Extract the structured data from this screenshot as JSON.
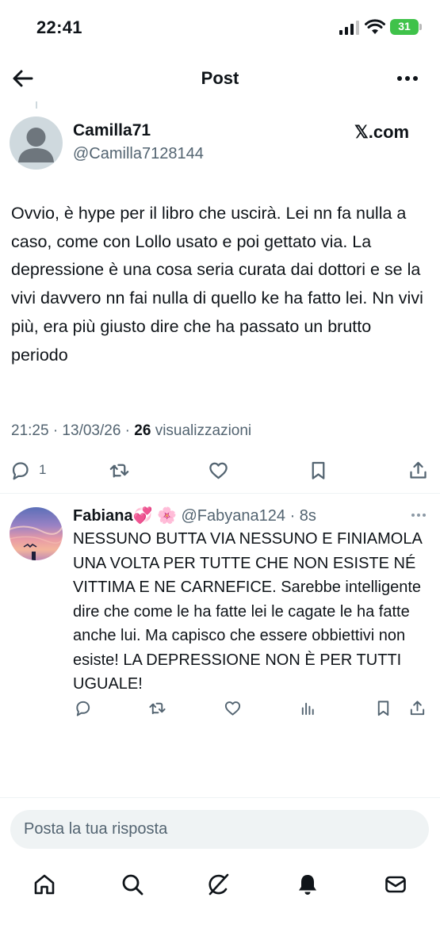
{
  "status_bar": {
    "time": "22:41",
    "battery": "31"
  },
  "header": {
    "title": "Post"
  },
  "post": {
    "author_name": "Camilla71",
    "author_handle": "@Camilla7128144",
    "brand": "𝕏.com",
    "text": "Ovvio, è hype per il libro che uscirà. Lei nn fa nulla a caso, come con Lollo usato e poi gettato via. La depressione è una cosa seria curata dai dottori e se la vivi davvero nn fai nulla di quello ke ha fatto lei. Nn vivi più, era più giusto dire che ha passato un brutto periodo",
    "timestamp": "21:25 · 13/03/26 · ",
    "views_count": "26",
    "views_label": " visualizzazioni",
    "reply_count": "1"
  },
  "reply": {
    "name": "Fabiana💞 🌸",
    "handle": "@Fabyana124",
    "time": " · 8s",
    "text": "NESSUNO BUTTA VIA NESSUNO E FINIAMOLA UNA VOLTA PER TUTTE CHE NON ESISTE NÉ VITTIMA E NE CARNEFICE. Sarebbe intelligente dire che come le ha fatte lei le cagate le ha fatte anche lui. Ma capisco che essere obbiettivi non esiste! LA DEPRESSIONE NON È PER TUTTI UGUALE!"
  },
  "composer": {
    "placeholder": "Posta la tua risposta"
  },
  "icons": {
    "header": [
      "back-arrow-icon",
      "more-icon"
    ],
    "post_actions": [
      "reply-icon",
      "repost-icon",
      "like-icon",
      "bookmark-icon",
      "share-icon"
    ],
    "reply_actions": [
      "reply-icon",
      "repost-icon",
      "like-icon",
      "views-icon",
      "bookmark-icon",
      "share-icon"
    ],
    "bottom_nav": [
      "home-icon",
      "search-icon",
      "grok-icon",
      "notifications-icon",
      "messages-icon"
    ]
  },
  "colors": {
    "text": "#0f1419",
    "secondary": "#536471",
    "battery": "#3fc24a",
    "input_bg": "#eff3f4"
  }
}
